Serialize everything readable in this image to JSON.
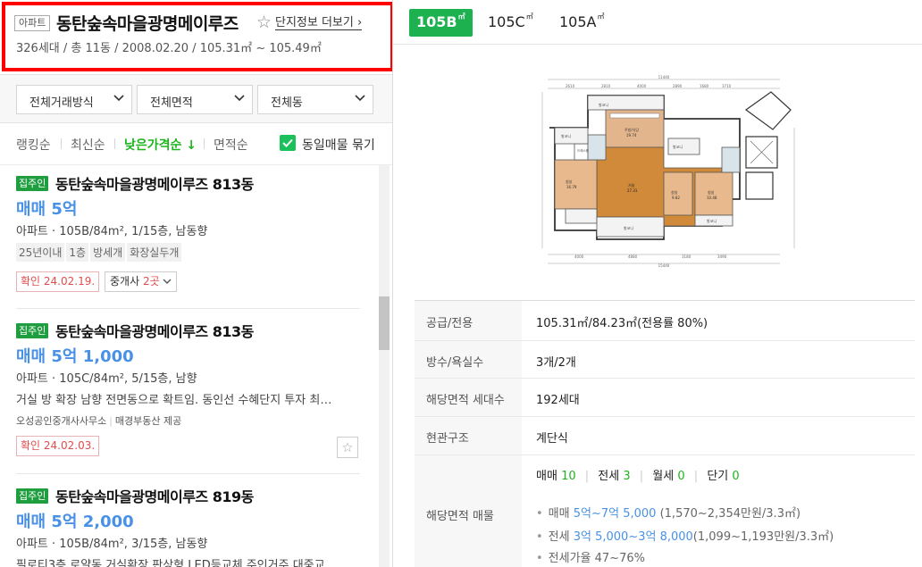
{
  "complex": {
    "type_tag": "아파트",
    "name": "동탄숲속마을광명메이루즈",
    "more_link": "단지정보 더보기",
    "summary": "326세대 / 총 11동 / 2008.02.20 / 105.31㎡ ~ 105.49㎡"
  },
  "filters": [
    "전체거래방식",
    "전체면적",
    "전체동"
  ],
  "sort": {
    "items": [
      "랭킹순",
      "최신순",
      "낮은가격순 ↓",
      "면적순"
    ],
    "merge_label": "동일매물 묶기"
  },
  "listings": [
    {
      "badge": "집주인",
      "title": "동탄숲속마을광명메이루즈 813동",
      "price": "매매 5억",
      "spec": "아파트 · 105B/84m², 1/15층, 남동향",
      "tags": [
        "25년이내",
        "1층",
        "방세개",
        "화장실두개"
      ],
      "confirm": "확인 24.02.19.",
      "broker_label": "중개사",
      "broker_count": "2곳"
    },
    {
      "badge": "집주인",
      "title": "동탄숲속마을광명메이루즈 813동",
      "price": "매매 5억 1,000",
      "spec": "아파트 · 105C/84m², 5/15층, 남향",
      "desc": "거실 방 확장 남향 전면동으로 확트임. 동인선 수혜단지 투자 최…",
      "agent": "오성공인중개사사무소",
      "provider": "매경부동산 제공",
      "confirm": "확인 24.02.03."
    },
    {
      "badge": "집주인",
      "title": "동탄숲속마을광명메이루즈 819동",
      "price": "매매 5억 2,000",
      "spec": "아파트 · 105B/84m², 3/15층, 남동향",
      "desc": "필로티3층 로얄동 거실확장 판상형 LED등교체 주인거주 대중교…"
    }
  ],
  "area_tabs": [
    {
      "label": "105B",
      "unit": "㎡"
    },
    {
      "label": "105C",
      "unit": "㎡"
    },
    {
      "label": "105A",
      "unit": "㎡"
    }
  ],
  "floorplan": {
    "rooms": [
      "발코니",
      "주방/식당",
      "19.74",
      "발코니",
      "드레스룸",
      "침실",
      "16.79",
      "거실",
      "27.31",
      "침실",
      "9.82",
      "침실",
      "10.48",
      "발코니",
      "발코니",
      "발코니"
    ],
    "dims_top": [
      "11440",
      "2610",
      "2810",
      "4000",
      "2890",
      "1680",
      "1710"
    ],
    "dims_bottom": [
      "4000",
      "4880",
      "3180",
      "3490",
      "15440"
    ]
  },
  "info": {
    "supply_label": "공급/전용",
    "supply_value": "105.31㎡/84.23㎡(전용률 80%)",
    "rooms_label": "방수/욕실수",
    "rooms_value": "3개/2개",
    "households_label": "해당면적 세대수",
    "households_value": "192세대",
    "entrance_label": "현관구조",
    "entrance_value": "계단식",
    "listings_label": "해당면적 매물",
    "counts": {
      "sale_label": "매매",
      "sale": "10",
      "jeonse_label": "전세",
      "jeonse": "3",
      "monthly_label": "월세",
      "monthly": "0",
      "short_label": "단기",
      "short": "0"
    },
    "sale_line": {
      "label": "매매",
      "range": "5억~7억 5,000",
      "rest": "(1,570~2,354만원/3.3㎡)"
    },
    "jeonse_line": {
      "label": "전세",
      "range": "3억 5,000~3억 8,000",
      "rest": "(1,099~1,193만원/3.3㎡)"
    },
    "ratio_line": "전세가율 47~76%"
  }
}
